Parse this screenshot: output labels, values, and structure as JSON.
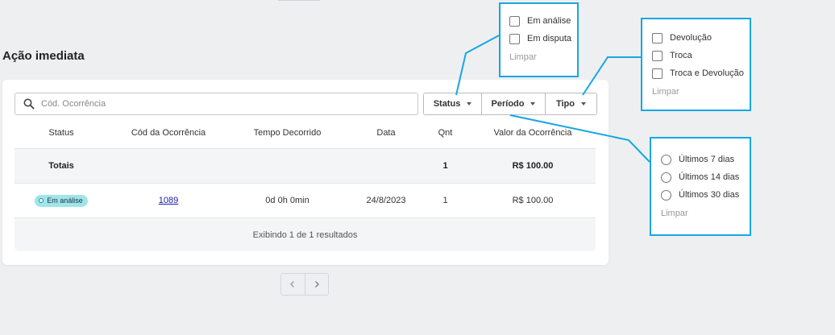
{
  "page": {
    "title": "Ação imediata"
  },
  "search": {
    "placeholder": "Cód. Ocorrência",
    "value": ""
  },
  "filters": {
    "status": "Status",
    "periodo": "Período",
    "tipo": "Tipo"
  },
  "table": {
    "headers": {
      "status": "Status",
      "cod": "Cód da Ocorrência",
      "tempo": "Tempo Decorrido",
      "data": "Data",
      "qnt": "Qnt",
      "valor": "Valor da Ocorrência"
    },
    "totals": {
      "label": "Totais",
      "qnt": "1",
      "valor": "R$ 100.00"
    },
    "rows": [
      {
        "status": "Em análise",
        "cod": "1089",
        "tempo": "0d 0h 0min",
        "data": "24/8/2023",
        "qnt": "1",
        "valor": "R$ 100.00"
      }
    ],
    "footer": "Exibindo 1 de 1 resultados"
  },
  "popups": {
    "status": {
      "options": [
        "Em análise",
        "Em disputa"
      ],
      "clear": "Limpar"
    },
    "tipo": {
      "options": [
        "Devolução",
        "Troca",
        "Troca e Devolução"
      ],
      "clear": "Limpar"
    },
    "periodo": {
      "options": [
        "Últimos 7 dias",
        "Últimos 14 dias",
        "Últimos 30 dias"
      ],
      "clear": "Limpar"
    }
  },
  "colors": {
    "accent_annotation": "#16a7e3",
    "badge_bg": "#9fe5ea",
    "link": "#1a1aa6"
  },
  "icons": {
    "search": "search-icon",
    "pager_prev": "chevron-left-icon",
    "pager_next": "chevron-right-icon"
  }
}
